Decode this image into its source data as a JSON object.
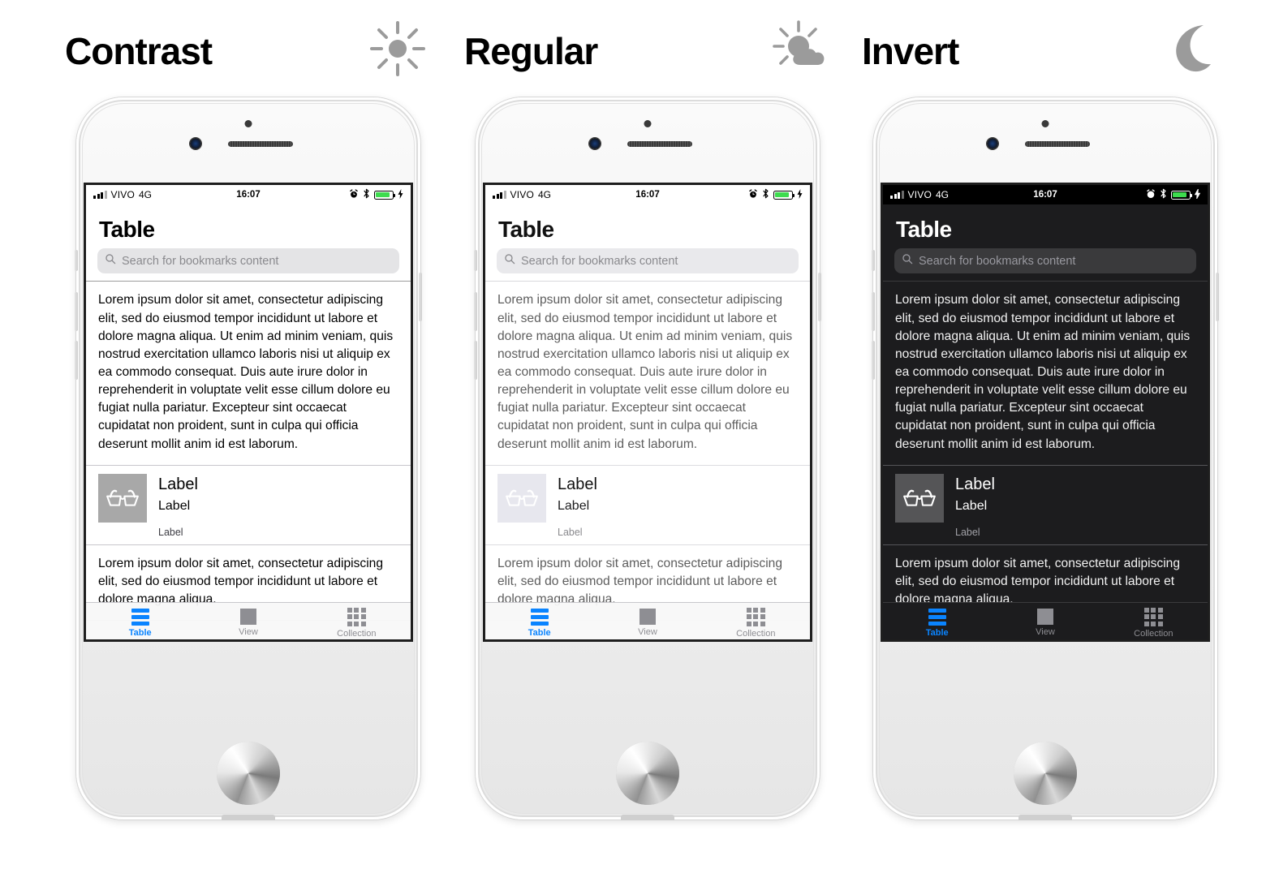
{
  "columns": [
    {
      "title": "Contrast",
      "icon_name": "sun-icon",
      "theme": "contrast"
    },
    {
      "title": "Regular",
      "icon_name": "sun-cloud-icon",
      "theme": "regular"
    },
    {
      "title": "Invert",
      "icon_name": "moon-icon",
      "theme": "invert"
    }
  ],
  "status_bar": {
    "carrier": "VIVO",
    "network": "4G",
    "time": "16:07",
    "icons": [
      "signal-icon",
      "alarm-icon",
      "bluetooth-icon",
      "battery-icon",
      "charging-bolt-icon"
    ]
  },
  "screen": {
    "title": "Table",
    "search": {
      "placeholder": "Search for bookmarks content",
      "value": ""
    },
    "paragraph": "Lorem ipsum dolor sit amet, consectetur adipiscing elit, sed do eiusmod tempor incididunt ut labore et dolore magna aliqua. Ut enim ad minim veniam, quis nostrud exercitation ullamco laboris nisi ut aliquip ex ea commodo consequat. Duis aute irure dolor in reprehenderit in voluptate velit esse cillum dolore eu fugiat nulla pariatur. Excepteur sint occaecat cupidatat non proident, sunt in culpa qui officia deserunt mollit anim id est laborum.",
    "paragraph_2": "Lorem ipsum dolor sit amet, consectetur adipiscing elit, sed do eiusmod tempor incididunt ut labore et dolore magna aliqua.",
    "list_item": {
      "thumbnail_icon": "glasses-icon",
      "title": "Label",
      "subtitle": "Label",
      "caption": "Label"
    },
    "tabs": [
      {
        "label": "Table",
        "icon": "table-rows-icon",
        "active": true
      },
      {
        "label": "View",
        "icon": "square-view-icon",
        "active": false
      },
      {
        "label": "Collection",
        "icon": "grid-collection-icon",
        "active": false
      }
    ]
  },
  "colors": {
    "accent": "#0a84ff",
    "battery_green": "#3ddc4e",
    "inactive_gray": "#8e8e93",
    "dark_bg": "#1c1c1e"
  }
}
